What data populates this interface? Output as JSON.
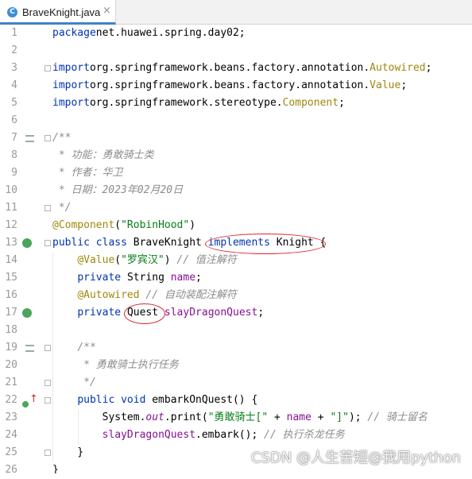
{
  "tab": {
    "icon_letter": "C",
    "title": "BraveKnight.java",
    "close": "×"
  },
  "lines": [
    {
      "num": "1",
      "parts": [
        [
          "kw",
          "package"
        ],
        [
          "",
          "net.huawei.spring.day02;"
        ]
      ]
    },
    {
      "num": "2",
      "parts": []
    },
    {
      "num": "3",
      "parts": [
        [
          "kw",
          "import"
        ],
        [
          "",
          "org.springframework.beans.factory.annotation."
        ],
        [
          "ann",
          "Autowired"
        ],
        [
          "",
          ";"
        ]
      ]
    },
    {
      "num": "4",
      "parts": [
        [
          "kw",
          "import"
        ],
        [
          "",
          "org.springframework.beans.factory.annotation."
        ],
        [
          "ann",
          "Value"
        ],
        [
          "",
          ";"
        ]
      ]
    },
    {
      "num": "5",
      "parts": [
        [
          "kw",
          "import"
        ],
        [
          "",
          "org.springframework.stereotype."
        ],
        [
          "ann",
          "Component"
        ],
        [
          "",
          ";"
        ]
      ]
    },
    {
      "num": "6",
      "parts": []
    },
    {
      "num": "7",
      "parts": [
        [
          "cmt",
          "/**"
        ]
      ]
    },
    {
      "num": "8",
      "parts": [
        [
          "cmt",
          " * 功能：勇敢骑士类"
        ]
      ]
    },
    {
      "num": "9",
      "parts": [
        [
          "cmt",
          " * 作者：华卫"
        ]
      ]
    },
    {
      "num": "10",
      "parts": [
        [
          "cmt",
          " * 日期：2023年02月20日"
        ]
      ]
    },
    {
      "num": "11",
      "parts": [
        [
          "cmt",
          " */"
        ]
      ]
    },
    {
      "num": "12",
      "parts": [
        [
          "ann",
          "@Component"
        ],
        [
          "",
          "("
        ],
        [
          "str",
          "\"RobinHood\""
        ],
        [
          "",
          ")"
        ]
      ]
    },
    {
      "num": "13",
      "parts": [
        [
          "kw",
          "public class "
        ],
        [
          "",
          "BraveKnight "
        ],
        [
          "kw",
          "implements "
        ],
        [
          "",
          "Knight {"
        ]
      ]
    },
    {
      "num": "14",
      "parts": [
        [
          "",
          "    "
        ],
        [
          "ann",
          "@Value"
        ],
        [
          "",
          "("
        ],
        [
          "str",
          "\"罗宾汉\""
        ],
        [
          "",
          ") "
        ],
        [
          "cmt",
          "// 值注解符"
        ]
      ]
    },
    {
      "num": "15",
      "parts": [
        [
          "",
          "    "
        ],
        [
          "kw",
          "private "
        ],
        [
          "",
          "String "
        ],
        [
          "field",
          "name"
        ],
        [
          "",
          ";"
        ]
      ]
    },
    {
      "num": "16",
      "parts": [
        [
          "",
          "    "
        ],
        [
          "ann",
          "@Autowired "
        ],
        [
          "cmt",
          "// 自动装配注解符"
        ]
      ]
    },
    {
      "num": "17",
      "parts": [
        [
          "",
          "    "
        ],
        [
          "kw",
          "private "
        ],
        [
          "",
          "Quest "
        ],
        [
          "field",
          "slayDragonQuest"
        ],
        [
          "",
          ";"
        ]
      ]
    },
    {
      "num": "18",
      "parts": []
    },
    {
      "num": "19",
      "parts": [
        [
          "",
          "    "
        ],
        [
          "cmt",
          "/**"
        ]
      ]
    },
    {
      "num": "20",
      "parts": [
        [
          "cmt",
          "     * 勇敢骑士执行任务"
        ]
      ]
    },
    {
      "num": "21",
      "parts": [
        [
          "cmt",
          "     */"
        ]
      ]
    },
    {
      "num": "22",
      "parts": [
        [
          "",
          "    "
        ],
        [
          "kw",
          "public void "
        ],
        [
          "",
          "embarkOnQuest() {"
        ]
      ]
    },
    {
      "num": "23",
      "parts": [
        [
          "",
          "        System."
        ],
        [
          "field italic",
          "out"
        ],
        [
          "",
          ".print("
        ],
        [
          "str",
          "\"勇敢骑士[\""
        ],
        [
          "",
          " + "
        ],
        [
          "field",
          "name"
        ],
        [
          "",
          " + "
        ],
        [
          "str",
          "\"]\""
        ],
        [
          "",
          "); "
        ],
        [
          "cmt",
          "// 骑士留名"
        ]
      ]
    },
    {
      "num": "24",
      "parts": [
        [
          "",
          "        "
        ],
        [
          "field",
          "slayDragonQuest"
        ],
        [
          "",
          ".embark(); "
        ],
        [
          "cmt",
          "// 执行杀龙任务"
        ]
      ]
    },
    {
      "num": "25",
      "parts": [
        [
          "",
          "    }"
        ]
      ]
    },
    {
      "num": "26",
      "parts": [
        [
          "",
          "}"
        ]
      ]
    }
  ],
  "watermark": "CSDN @人生苦短@我用python",
  "colors": {
    "keyword": "#0033b3",
    "annotation": "#9e880d",
    "string": "#067d17",
    "field": "#871094",
    "comment": "#8c8c8c",
    "highlight": "#e0242b"
  }
}
